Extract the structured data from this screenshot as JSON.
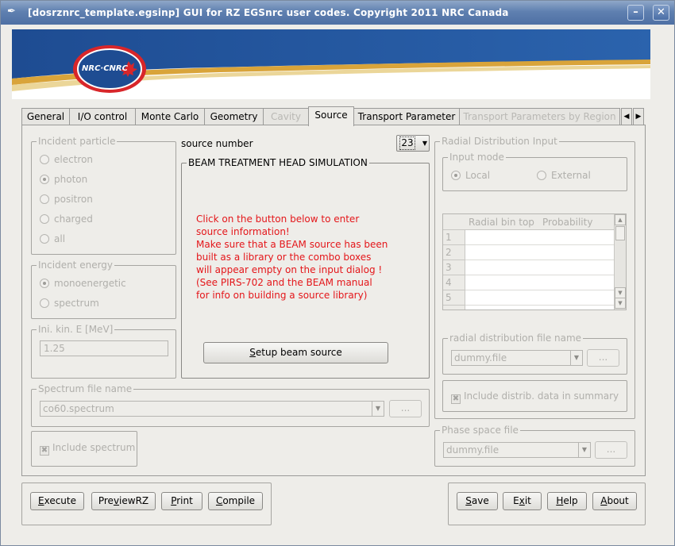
{
  "window": {
    "title": "[dosrznrc_template.egsinp] GUI for RZ EGSnrc user codes. Copyright 2011 NRC Canada",
    "minimize_label": "–",
    "close_label": "✕"
  },
  "banner": {
    "logo_text": "NRC·CNRC"
  },
  "tabs": [
    {
      "label": "General"
    },
    {
      "label": "I/O control"
    },
    {
      "label": "Monte Carlo"
    },
    {
      "label": "Geometry"
    },
    {
      "label": "Cavity"
    },
    {
      "label": "Source"
    },
    {
      "label": "Transport Parameter"
    },
    {
      "label": "Transport Parameters by Region"
    }
  ],
  "incident_particle": {
    "legend": "Incident particle",
    "options": [
      "electron",
      "photon",
      "positron",
      "charged",
      "all"
    ],
    "selected": "photon"
  },
  "incident_energy": {
    "legend": "Incident energy",
    "options": [
      "monoenergetic",
      "spectrum"
    ],
    "selected": "monoenergetic"
  },
  "ini_kin_e": {
    "legend": "Ini. kin. E [MeV]",
    "value": "1.25"
  },
  "source_number": {
    "label": "source number",
    "value": "23"
  },
  "beam": {
    "legend": "BEAM TREATMENT HEAD SIMULATION",
    "lines": [
      "Click on the button below to enter",
      "source information!",
      "Make sure that a BEAM source has been",
      "built as a library or the combo boxes",
      "will appear empty on the input dialog !",
      "(See PIRS-702 and the BEAM manual",
      "for info on building a source library)"
    ],
    "setup_prefix": "S",
    "setup_rest": "etup beam source"
  },
  "spectrum_file": {
    "legend": "Spectrum file name",
    "value": "co60.spectrum",
    "browse_label": "..."
  },
  "include_spectrum": {
    "label": "Include spectrum"
  },
  "radial": {
    "legend": "Radial Distribution Input",
    "input_mode_legend": "Input mode",
    "modes": [
      "Local",
      "External"
    ],
    "selected": "Local",
    "columns": [
      "Radial bin top",
      "Probability"
    ],
    "row_numbers": [
      "1",
      "2",
      "3",
      "4",
      "5"
    ],
    "file_legend": "radial distribution file name",
    "file_value": "dummy.file",
    "browse_label": "...",
    "include_label": "Include distrib. data in summary"
  },
  "phase_space": {
    "legend": "Phase space file",
    "value": "dummy.file",
    "browse_label": "..."
  },
  "buttons_left": [
    {
      "key": "E",
      "rest": "xecute"
    },
    {
      "pre": "Pre",
      "key": "v",
      "rest": "iewRZ"
    },
    {
      "key": "P",
      "rest": "rint"
    },
    {
      "key": "C",
      "rest": "ompile"
    }
  ],
  "buttons_right": [
    {
      "key": "S",
      "rest": "ave"
    },
    {
      "pre": "E",
      "key": "x",
      "rest": "it"
    },
    {
      "key": "H",
      "rest": "elp"
    },
    {
      "key": "A",
      "rest": "bout"
    }
  ]
}
